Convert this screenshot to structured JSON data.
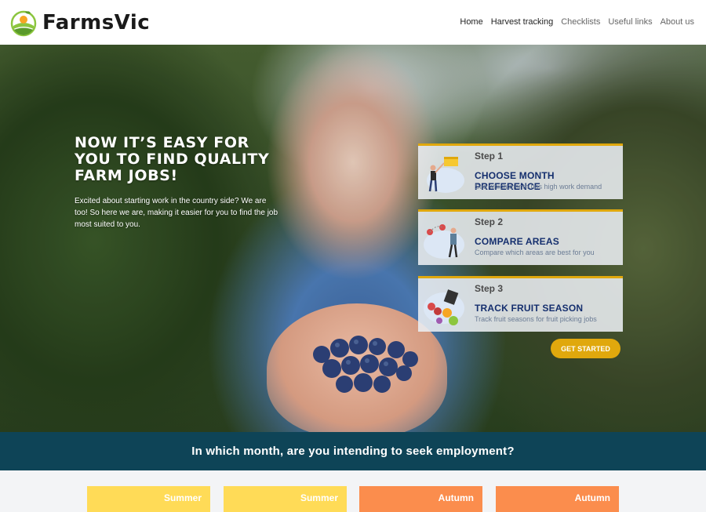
{
  "brand": {
    "name": "FarmsVic"
  },
  "nav": {
    "items": [
      {
        "label": "Home",
        "active": true
      },
      {
        "label": "Harvest tracking",
        "active": true
      },
      {
        "label": "Checklists",
        "active": false
      },
      {
        "label": "Useful links",
        "active": false
      },
      {
        "label": "About us",
        "active": false
      }
    ]
  },
  "hero": {
    "title": "NOW IT’S EASY FOR YOU TO FIND QUALITY FARM JOBS!",
    "subtitle": "Excited about starting work in the country side? We are too! So here we are, making it easier for you to find the job most suited to you."
  },
  "steps": [
    {
      "number": "Step 1",
      "title": "CHOOSE MONTH PREFERENCE",
      "description": "See which month has high work demand",
      "icon": "calendar-person-icon"
    },
    {
      "number": "Step 2",
      "title": "COMPARE AREAS",
      "description": "Compare which areas are best for you",
      "icon": "map-person-icon"
    },
    {
      "number": "Step 3",
      "title": "TRACK FRUIT SEASON",
      "description": "Track fruit seasons for fruit picking jobs",
      "icon": "fruit-icon"
    }
  ],
  "cta": {
    "label": "GET STARTED"
  },
  "banner": {
    "text": "In which month, are you intending to seek employment?"
  },
  "seasons": [
    {
      "label": "Summer",
      "color": "#ffdb57"
    },
    {
      "label": "Summer",
      "color": "#ffdb57"
    },
    {
      "label": "Autumn",
      "color": "#fb8d4d"
    },
    {
      "label": "Autumn",
      "color": "#fb8d4d"
    }
  ],
  "colors": {
    "accent": "#e0a80d",
    "banner": "#0e4457",
    "step_title": "#152f6e"
  }
}
